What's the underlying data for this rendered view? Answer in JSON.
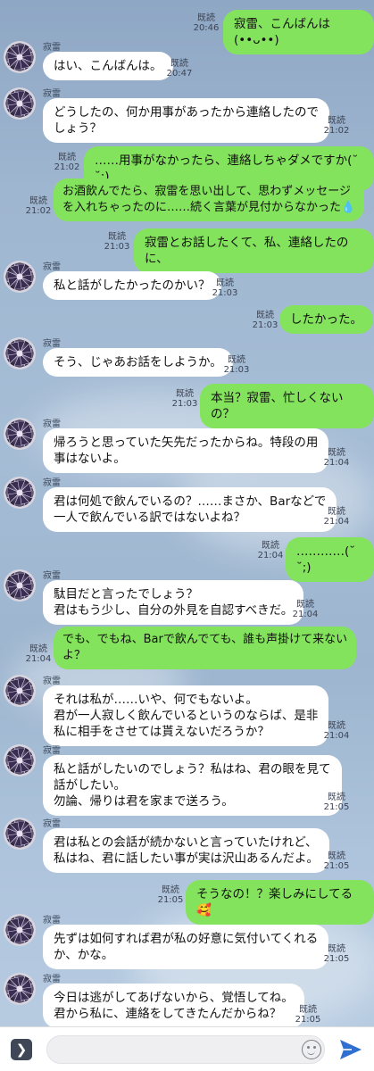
{
  "contact": {
    "name": "寂雷"
  },
  "messages": [
    {
      "side": "out",
      "text": "寂雷、こんばんは(••ᴗ••)",
      "read": "既読",
      "time": "20:46"
    },
    {
      "side": "in",
      "name": "寂雷",
      "text": "はい、こんばんは。",
      "read": "既読",
      "time": "20:47"
    },
    {
      "side": "in",
      "name": "寂雷",
      "text": "どうしたの、何か用事があったから連絡したので\nしょう？",
      "read": "既読",
      "time": "21:02"
    },
    {
      "side": "out",
      "text": "……用事がなかったら、連絡しちゃダメですか(˘ ˘;)",
      "read": "既読",
      "time": "21:02"
    },
    {
      "side": "out",
      "text": "お酒飲んでたら、寂雷を思い出して、思わずメッセージ\nを入れちゃったのに……続く言葉が見付からなかった💧",
      "read": "既読",
      "time": "21:02"
    },
    {
      "side": "out",
      "text": "寂雷とお話したくて、私、連絡したのに、",
      "read": "既読",
      "time": "21:03"
    },
    {
      "side": "in",
      "name": "寂雷",
      "text": "私と話がしたかったのかい？",
      "read": "既読",
      "time": "21:03"
    },
    {
      "side": "out",
      "text": "したかった。",
      "read": "既読",
      "time": "21:03"
    },
    {
      "side": "in",
      "name": "寂雷",
      "text": "そう、じゃあお話をしようか。",
      "read": "既読",
      "time": "21:03"
    },
    {
      "side": "out",
      "text": "本当？寂雷、忙しくないの？",
      "read": "既読",
      "time": "21:03"
    },
    {
      "side": "in",
      "name": "寂雷",
      "text": "帰ろうと思っていた矢先だったからね。特段の用\n事はないよ。",
      "read": "既読",
      "time": "21:04"
    },
    {
      "side": "in",
      "name": "寂雷",
      "text": "君は何処で飲んでいるの？……まさか、Barなどで\n一人で飲んでいる訳ではないよね？",
      "read": "既読",
      "time": "21:04"
    },
    {
      "side": "out",
      "text": "…………(˘ ˘;)",
      "read": "既読",
      "time": "21:04"
    },
    {
      "side": "in",
      "name": "寂雷",
      "text": "駄目だと言ったでしょう？\n君はもう少し、自分の外見を自認すべきだ。",
      "read": "既読",
      "time": "21:04"
    },
    {
      "side": "out",
      "text": "でも、でもね、Barで飲んでても、誰も声掛けて来ない\nよ？",
      "read": "既読",
      "time": "21:04"
    },
    {
      "side": "in",
      "name": "寂雷",
      "text": "それは私が……いや、何でもないよ。\n君が一人寂しく飲んでいるというのならば、是非\n私に相手をさせては貰えないだろうか？",
      "read": "既読",
      "time": "21:04"
    },
    {
      "side": "in",
      "name": "寂雷",
      "text": "私と話がしたいのでしょう？私はね、君の眼を見て\n話がしたい。\n勿論、帰りは君を家まで送ろう。",
      "read": "既読",
      "time": "21:05"
    },
    {
      "side": "in",
      "name": "寂雷",
      "text": "君は私との会話が続かないと言っていたけれど、\n私はね、君に話したい事が実は沢山あるんだよ。",
      "read": "既読",
      "time": "21:05"
    },
    {
      "side": "out",
      "text": "そうなの！？楽しみにしてる🥰",
      "read": "既読",
      "time": "21:05"
    },
    {
      "side": "in",
      "name": "寂雷",
      "text": "先ずは如何すれば君が私の好意に気付いてくれる\nか、かな。",
      "read": "既読",
      "time": "21:05"
    },
    {
      "side": "in",
      "name": "寂雷",
      "text": "今日は逃がしてあげないから、覚悟してね。\n君から私に、連絡をしてきたんだからね？",
      "read": "既読",
      "time": "21:05"
    }
  ],
  "input": {
    "placeholder": ""
  },
  "icons": {
    "expand": "chevron-right-icon",
    "emoji": "smiley-icon",
    "send": "send-icon"
  },
  "colors": {
    "outgoing": "#84e35c",
    "incoming": "#ffffff"
  }
}
